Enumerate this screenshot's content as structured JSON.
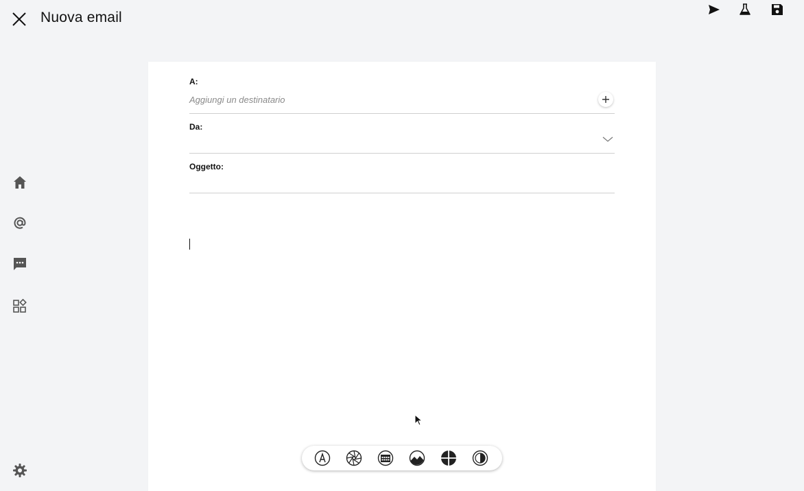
{
  "header": {
    "title": "Nuova email",
    "icons": [
      "close-icon",
      "send-icon",
      "flask-icon",
      "save-icon"
    ]
  },
  "sidebar": {
    "items": [
      {
        "icon": "home-icon"
      },
      {
        "icon": "at-sign-icon"
      },
      {
        "icon": "chat-icon"
      },
      {
        "icon": "apps-grid-icon"
      }
    ],
    "footer_icon": "gear-icon"
  },
  "compose": {
    "to_label": "A:",
    "to_placeholder": "Aggiungi un destinatario",
    "from_label": "Da:",
    "from_value": "",
    "subject_label": "Oggetto:",
    "subject_value": "",
    "body": ""
  },
  "toolbar": {
    "tools": [
      "pen-nib-icon",
      "aperture-icon",
      "calendar-icon",
      "landscape-icon",
      "crosshair-icon",
      "contrast-icon"
    ]
  },
  "colors": {
    "background": "#f3f4f6",
    "card": "#ffffff",
    "text": "#111111",
    "placeholder": "#8a8a8a",
    "divider": "#cfcfcf"
  }
}
